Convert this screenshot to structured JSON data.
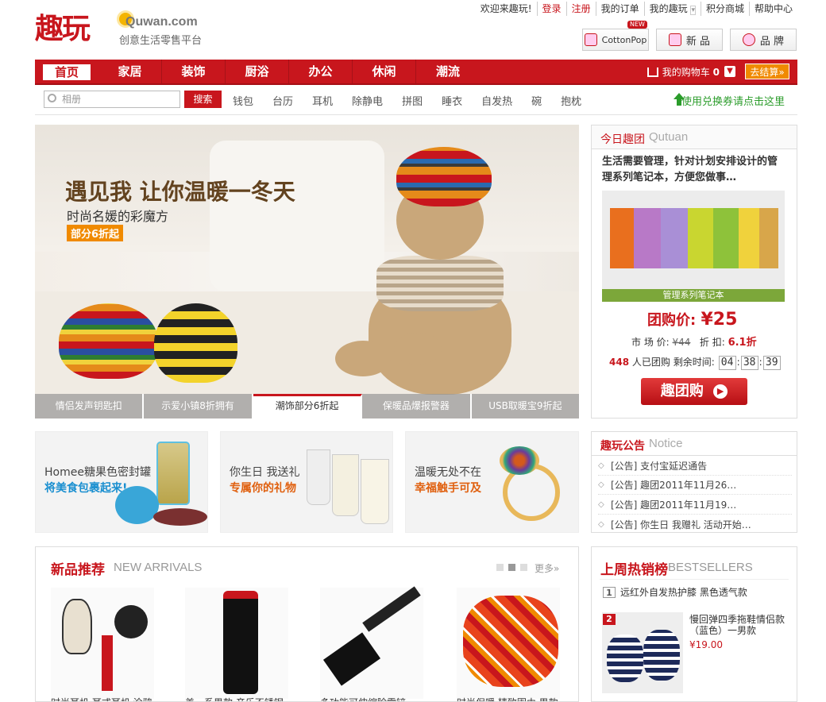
{
  "header": {
    "logo_text": "趣玩",
    "logo_domain": "Quwan.com",
    "slogan": "创意生活零售平台",
    "toplinks": [
      "欢迎来趣玩!",
      "登录",
      "注册",
      "我的订单",
      "我的趣玩",
      "积分商城",
      "帮助中心"
    ],
    "badges": {
      "cottonpop": "CottonPop",
      "cottonpop_new": "NEW",
      "new": "新 品",
      "brand": "品 牌"
    }
  },
  "nav": {
    "items": [
      "首页",
      "家居",
      "装饰",
      "厨浴",
      "办公",
      "休闲",
      "潮流"
    ],
    "cart_label": "我的购物车",
    "cart_count": "0",
    "checkout": "去结算»"
  },
  "search": {
    "placeholder": "相册",
    "button": "搜索",
    "hotwords": [
      "钱包",
      "台历",
      "耳机",
      "除静电",
      "拼图",
      "睡衣",
      "自发热",
      "碗",
      "抱枕"
    ],
    "coupon": "使用兑换券请点击这里"
  },
  "banner": {
    "title": "遇见我 让你温暖一冬天",
    "subtitle": "时尚名媛的彩魔方",
    "tag": "部分6折起",
    "thumbs": [
      "情侣发声钥匙扣",
      "示爱小镇8折拥有",
      "潮饰部分6折起",
      "保暖品爆报警器",
      "USB取暖宝9折起"
    ],
    "active_thumb": 2
  },
  "promos": [
    {
      "line1": "Homee糖果色密封罐",
      "line2": "将美食包裹起来!",
      "color": "#1a8fd0"
    },
    {
      "line1": "你生日 我送礼",
      "line2": "专属你的礼物",
      "color": "#e0600f"
    },
    {
      "line1": "温暖无处不在",
      "line2": "幸福触手可及",
      "color": "#e0600f"
    }
  ],
  "tuan": {
    "title_cn": "今日趣团",
    "title_en": "Qutuan",
    "desc": "生活需要管理，针对计划安排设计的管理系列笔记本，方便您做事…",
    "caption": "管理系列笔记本",
    "price_label": "团购价:",
    "price": "¥25",
    "market_label": "市 场 价:",
    "market_price": "¥44",
    "discount_label": "折  扣:",
    "discount": "6.1折",
    "buyers": "448",
    "buyers_label": "人已团购",
    "remain_label": "剩余时间:",
    "time": [
      "04",
      "38",
      "39"
    ],
    "button": "趣团购"
  },
  "notice": {
    "title_cn": "趣玩公告",
    "title_en": "Notice",
    "items": [
      "[公告] 支付宝延迟通告",
      "[公告] 趣团2011年11月26…",
      "[公告] 趣团2011年11月19…",
      "[公告] 你生日 我赠礼 活动开始…"
    ]
  },
  "new_arrivals": {
    "title_cn": "新品推荐",
    "title_en": "NEW ARRIVALS",
    "more": "更多",
    "products": [
      "时尚耳机 耳式耳机 涂鸦",
      "美一系男款 音乐不锈钢保温杯",
      "多功能可伸缩除雪铲",
      "时尚保暖 精致围巾 男款"
    ]
  },
  "bestsellers": {
    "title_cn": "上周热销榜",
    "title_en": "BESTSELLERS",
    "first": "远红外自发热护膝 黑色透气款",
    "second_name": "慢回弹四季拖鞋情侣款（蓝色）一男款",
    "second_price": "¥19.00"
  },
  "colors": {
    "brand_red": "#c8161d",
    "orange": "#f08a00",
    "green": "#2b9c2b"
  }
}
